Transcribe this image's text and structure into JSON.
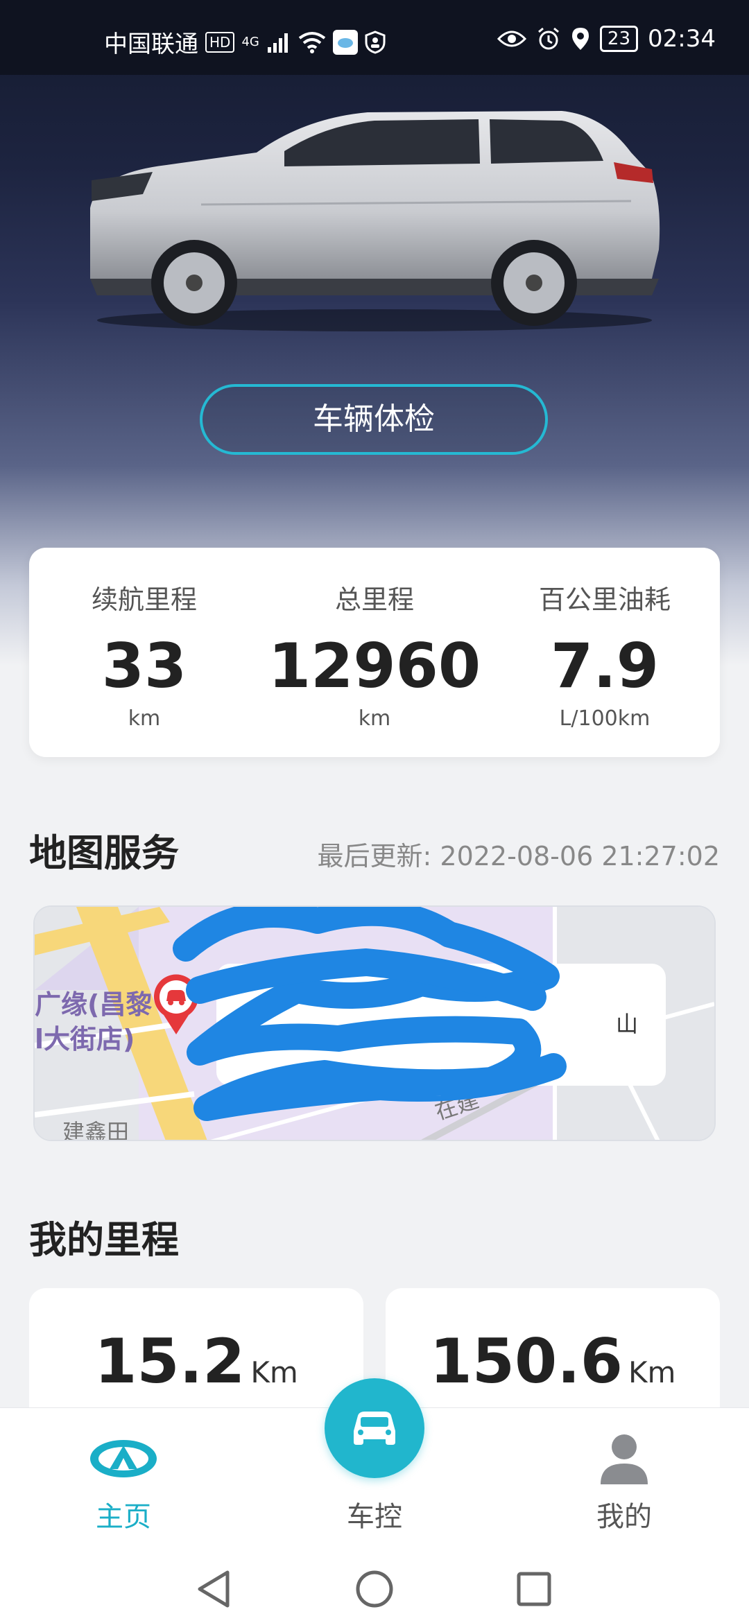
{
  "status_bar": {
    "carrier": "中国联通",
    "hd_badge": "HD",
    "network": "4G",
    "battery": "23",
    "time": "02:34"
  },
  "hero": {
    "check_button_label": "车辆体检"
  },
  "stats": [
    {
      "label": "续航里程",
      "value": "33",
      "unit": "km"
    },
    {
      "label": "总里程",
      "value": "12960",
      "unit": "km"
    },
    {
      "label": "百公里油耗",
      "value": "7.9",
      "unit": "L/100km"
    }
  ],
  "map_section": {
    "title": "地图服务",
    "updated_label": "最后更新:",
    "updated_time": "2022-08-06 21:27:02",
    "poi_line1": "广缘(昌黎",
    "poi_line2": "l大街店)",
    "road_text_1": "在建",
    "road_text_2": "建鑫田",
    "popup_tail": "山"
  },
  "mileage_section": {
    "title": "我的里程",
    "cards": [
      {
        "value": "15.2",
        "unit": "Km"
      },
      {
        "value": "150.6",
        "unit": "Km"
      }
    ]
  },
  "tabbar": {
    "home": "主页",
    "control": "车控",
    "mine": "我的"
  },
  "colors": {
    "accent": "#1aaec7",
    "fab": "#21b6cd",
    "map_bg": "#e8e0f4",
    "map_road": "#f7d77a",
    "marker": "#e5383b",
    "scribble": "#1f86e3"
  }
}
